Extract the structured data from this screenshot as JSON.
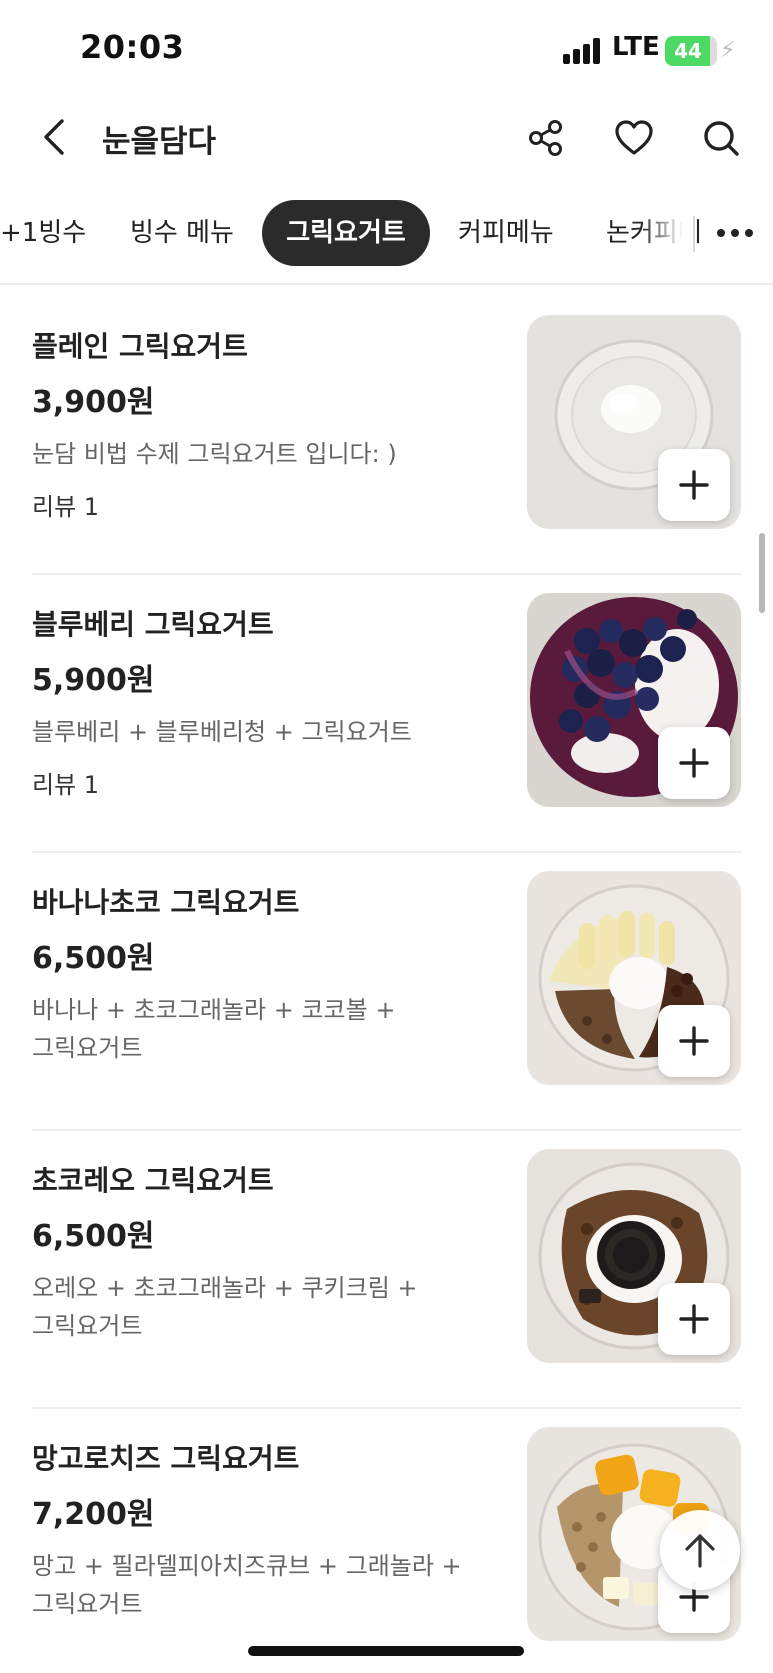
{
  "status_bar": {
    "time": "20:03",
    "network": "LTE",
    "battery_level": "44",
    "battery_fill": 0.44
  },
  "header": {
    "title": "눈을담다",
    "icons": [
      "chevron-left-icon",
      "share-icon",
      "heart-icon",
      "search-icon"
    ]
  },
  "category_tabs": [
    {
      "label": "+1빙수",
      "active": false
    },
    {
      "label": "빙수 메뉴",
      "active": false
    },
    {
      "label": "그릭요거트",
      "active": true
    },
    {
      "label": "커피메뉴",
      "active": false
    },
    {
      "label": "논커피메",
      "active": false
    }
  ],
  "menu_items": [
    {
      "name": "플레인 그릭요거트",
      "price": "3,900원",
      "description": "눈담 비법 수제 그릭요거트 입니다: )",
      "review": "리뷰 1"
    },
    {
      "name": "블루베리 그릭요거트",
      "price": "5,900원",
      "description": "블루베리 + 블루베리청 + 그릭요거트",
      "review": "리뷰 1"
    },
    {
      "name": "바나나초코 그릭요거트",
      "price": "6,500원",
      "description": "바나나 + 초코그래놀라 + 코코볼 + 그릭요거트",
      "review": ""
    },
    {
      "name": "초코레오 그릭요거트",
      "price": "6,500원",
      "description": "오레오 + 초코그래놀라 + 쿠키크림 + 그릭요거트",
      "review": ""
    },
    {
      "name": "망고로치즈 그릭요거트",
      "price": "7,200원",
      "description": "망고 + 필라델피아치즈큐브 + 그래놀라 + 그릭요거트",
      "review": ""
    }
  ],
  "colors": {
    "active_tab": "#2b2b2b",
    "text": "#222222",
    "secondary_text": "#666666",
    "battery": "#4cd964"
  }
}
